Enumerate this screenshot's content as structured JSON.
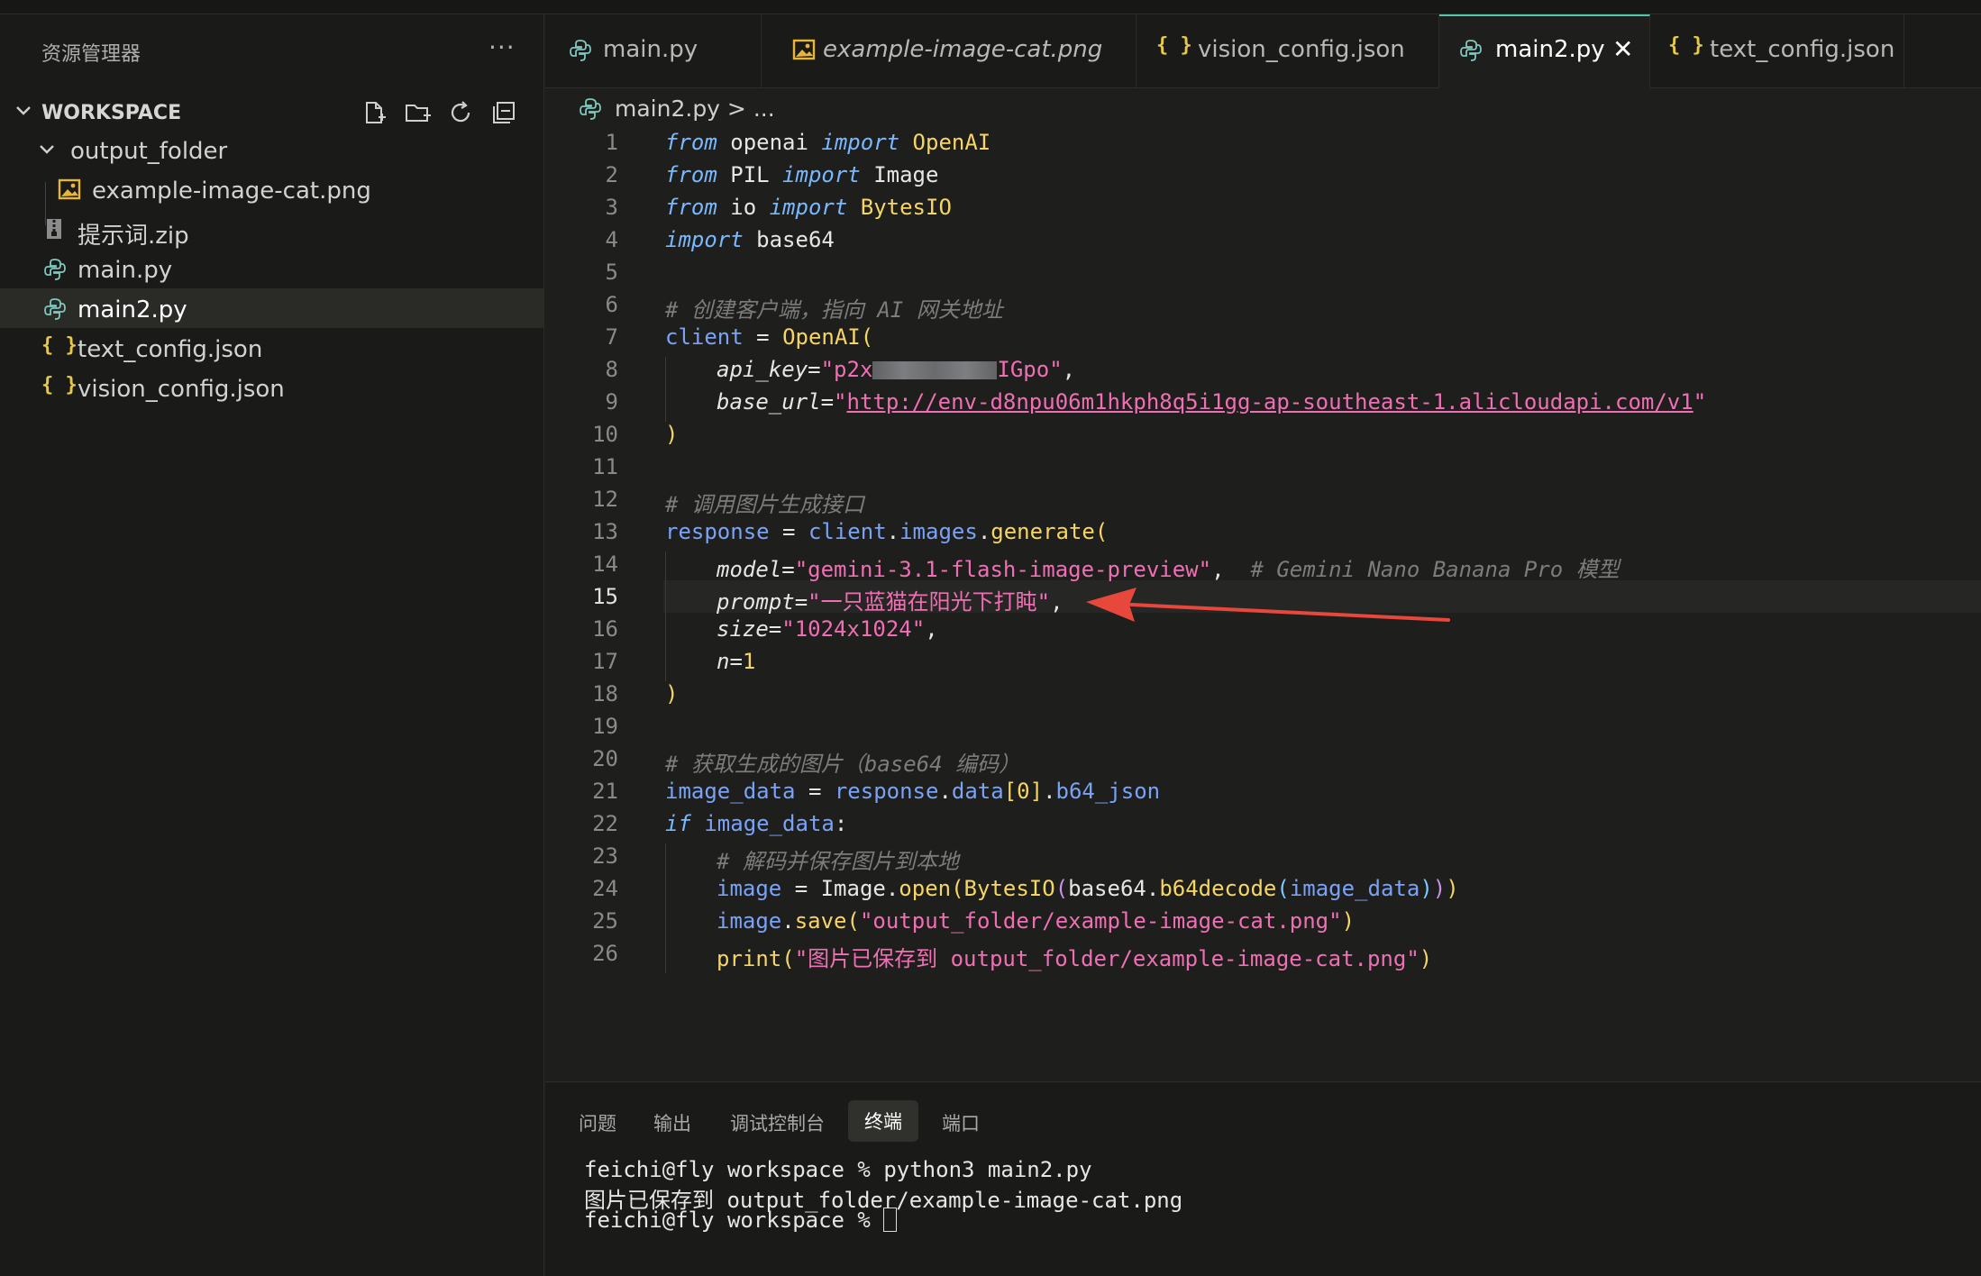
{
  "colors": {
    "accent": "#4ec9b0",
    "arrow": "#e8473c"
  },
  "sidebar": {
    "title": "资源管理器",
    "more": "···",
    "workspace_label": "WORKSPACE",
    "items": [
      {
        "label": "output_folder",
        "icon": "chevron-down-icon"
      },
      {
        "label": "example-image-cat.png",
        "icon": "image-file-icon"
      },
      {
        "label": "提示词.zip",
        "icon": "zip-file-icon"
      },
      {
        "label": "main.py",
        "icon": "python-file-icon"
      },
      {
        "label": "main2.py",
        "icon": "python-file-icon"
      },
      {
        "label": "text_config.json",
        "icon": "json-file-icon"
      },
      {
        "label": "vision_config.json",
        "icon": "json-file-icon"
      }
    ]
  },
  "tabs": [
    {
      "label": "main.py",
      "icon": "python-file-icon"
    },
    {
      "label": "example-image-cat.png",
      "icon": "image-file-icon"
    },
    {
      "label": "vision_config.json",
      "icon": "json-file-icon"
    },
    {
      "label": "main2.py",
      "icon": "python-file-icon",
      "close": "✕"
    },
    {
      "label": "text_config.json",
      "icon": "json-file-icon"
    }
  ],
  "breadcrumb": {
    "file": "main2.py",
    "rest": " > ..."
  },
  "editor": {
    "current_line": 15,
    "line_numbers": [
      "1",
      "2",
      "3",
      "4",
      "5",
      "6",
      "7",
      "8",
      "9",
      "10",
      "11",
      "12",
      "13",
      "14",
      "15",
      "16",
      "17",
      "18",
      "19",
      "20",
      "21",
      "22",
      "23",
      "24",
      "25",
      "26"
    ],
    "code": {
      "l1": {
        "k1": "from",
        "t1": " openai ",
        "k2": "import",
        "c": " OpenAI"
      },
      "l2": {
        "k1": "from",
        "t1": " PIL ",
        "k2": "import",
        "t2": " Image"
      },
      "l3": {
        "k1": "from",
        "t1": " io ",
        "k2": "import",
        "c": " BytesIO"
      },
      "l4": {
        "k1": "import",
        "t1": " base64"
      },
      "l6": "# 创建客户端，指向 AI 网关地址",
      "l7": {
        "v": "client",
        "t": " = ",
        "c": "OpenAI",
        "p": "("
      },
      "l8": {
        "prm": "api_key",
        "eq": "=",
        "s1": "\"p2x",
        "s2": "IGpo\"",
        "end": ","
      },
      "l9": {
        "prm": "base_url",
        "eq": "=",
        "q1": "\"",
        "url": "http://env-d8npu06m1hkph8q5i1gg-ap-southeast-1.alicloudapi.com/v1",
        "q2": "\""
      },
      "l10": ")",
      "l12": "# 调用图片生成接口",
      "l13": {
        "v1": "response",
        "t": " = ",
        "v2": "client",
        "d1": ".",
        "v3": "images",
        "d2": ".",
        "f": "generate",
        "p": "("
      },
      "l14": {
        "prm": "model",
        "eq": "=",
        "s": "\"gemini-3.1-flash-image-preview\"",
        "end": ",  ",
        "cm": "# Gemini Nano Banana Pro 模型"
      },
      "l15": {
        "prm": "prompt",
        "eq": "=",
        "s": "\"一只蓝猫在阳光下打盹\"",
        "end": ","
      },
      "l16": {
        "prm": "size",
        "eq": "=",
        "s": "\"1024x1024\"",
        "end": ","
      },
      "l17": {
        "prm": "n",
        "eq": "=",
        "num": "1"
      },
      "l18": ")",
      "l20": "# 获取生成的图片（base64 编码）",
      "l21": {
        "v1": "image_data",
        "t": " = ",
        "v2": "response",
        "d1": ".",
        "v3": "data",
        "b1": "[",
        "n": "0",
        "b2": "]",
        "d2": ".",
        "v4": "b64_json"
      },
      "l22": {
        "k": "if",
        "sp": " ",
        "v": "image_data",
        "c": ":"
      },
      "l23": "# 解码并保存图片到本地",
      "l24": {
        "v": "image",
        "t": " = Image.",
        "f1": "open",
        "p1": "(",
        "f2": "BytesIO",
        "p2": "(",
        "t2": "base64.",
        "f3": "b64decode",
        "p3": "(",
        "v2": "image_data",
        "p3e": ")",
        "p2e": ")",
        "p1e": ")"
      },
      "l25": {
        "v": "image",
        "d": ".",
        "f": "save",
        "p1": "(",
        "s": "\"output_folder/example-image-cat.png\"",
        "p2": ")"
      },
      "l26": {
        "f": "print",
        "p1": "(",
        "s": "\"图片已保存到 output_folder/example-image-cat.png\"",
        "p2": ")"
      }
    }
  },
  "panel": {
    "tabs": [
      "问题",
      "输出",
      "调试控制台",
      "终端",
      "端口"
    ],
    "active_tab": "终端",
    "terminal": [
      "feichi@fly workspace % python3 main2.py",
      "图片已保存到 output_folder/example-image-cat.png",
      "feichi@fly workspace % "
    ]
  }
}
